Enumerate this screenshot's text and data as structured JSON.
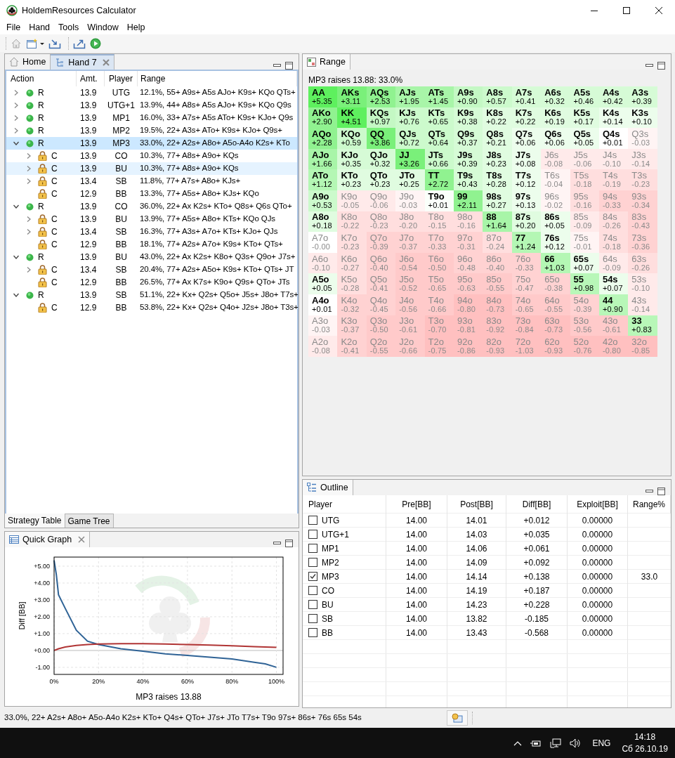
{
  "window": {
    "title": "HoldemResources Calculator"
  },
  "menu": [
    "File",
    "Hand",
    "Tools",
    "Window",
    "Help"
  ],
  "editor_tabs": [
    {
      "label": "Home",
      "selected": false,
      "closable": false
    },
    {
      "label": "Hand 7",
      "selected": true,
      "closable": true
    }
  ],
  "strategy_table": {
    "columns": [
      "Action",
      "Amt.",
      "Player",
      "Range"
    ],
    "rows": [
      {
        "action": "R",
        "kind": "raise",
        "amount": "13.9",
        "player": "UTG",
        "range": "12.1%, 55+ A9s+ A5s AJo+ K9s+ KQo QTs+",
        "expanded": false,
        "selected": false
      },
      {
        "action": "R",
        "kind": "raise",
        "amount": "13.9",
        "player": "UTG+1",
        "range": "13.9%, 44+ A8s+ A5s AJo+ K9s+ KQo Q9s",
        "expanded": false,
        "selected": false
      },
      {
        "action": "R",
        "kind": "raise",
        "amount": "13.9",
        "player": "MP1",
        "range": "16.0%, 33+ A7s+ A5s ATo+ K9s+ KJo+ Q9s",
        "expanded": false,
        "selected": false
      },
      {
        "action": "R",
        "kind": "raise",
        "amount": "13.9",
        "player": "MP2",
        "range": "19.5%, 22+ A3s+ ATo+ K9s+ KJo+ Q9s+",
        "expanded": false,
        "selected": false
      },
      {
        "action": "R",
        "kind": "raise",
        "amount": "13.9",
        "player": "MP3",
        "range": "33.0%, 22+ A2s+ A8o+ A5o-A4o K2s+ KTo",
        "expanded": true,
        "selected": true,
        "children": [
          {
            "action": "C",
            "kind": "call",
            "amount": "13.9",
            "player": "CO",
            "range": "10.3%, 77+ A8s+ A9o+ KQs",
            "expanded": false,
            "selected": false
          },
          {
            "action": "C",
            "kind": "call",
            "amount": "13.9",
            "player": "BU",
            "range": "10.3%, 77+ A8s+ A9o+ KQs",
            "expanded": false,
            "selected": false,
            "highlighted": true
          },
          {
            "action": "C",
            "kind": "call",
            "amount": "13.4",
            "player": "SB",
            "range": "11.8%, 77+ A7s+ A8o+ KJs+",
            "expanded": false,
            "selected": false
          },
          {
            "action": "C",
            "kind": "call",
            "amount": "12.9",
            "player": "BB",
            "range": "13.3%, 77+ A5s+ A8o+ KJs+ KQo",
            "selected": false
          }
        ]
      },
      {
        "action": "R",
        "kind": "raise",
        "amount": "13.9",
        "player": "CO",
        "range": "36.0%, 22+ Ax K2s+ KTo+ Q8s+ Q6s QTo+",
        "expanded": true,
        "selected": false,
        "children": [
          {
            "action": "C",
            "kind": "call",
            "amount": "13.9",
            "player": "BU",
            "range": "13.9%, 77+ A5s+ A8o+ KTs+ KQo QJs",
            "expanded": false,
            "selected": false
          },
          {
            "action": "C",
            "kind": "call",
            "amount": "13.4",
            "player": "SB",
            "range": "16.3%, 77+ A3s+ A7o+ KTs+ KJo+ QJs",
            "expanded": false,
            "selected": false
          },
          {
            "action": "C",
            "kind": "call",
            "amount": "12.9",
            "player": "BB",
            "range": "18.1%, 77+ A2s+ A7o+ K9s+ KTo+ QTs+",
            "selected": false
          }
        ]
      },
      {
        "action": "R",
        "kind": "raise",
        "amount": "13.9",
        "player": "BU",
        "range": "43.0%, 22+ Ax K2s+ K8o+ Q3s+ Q9o+ J7s+",
        "expanded": true,
        "selected": false,
        "children": [
          {
            "action": "C",
            "kind": "call",
            "amount": "13.4",
            "player": "SB",
            "range": "20.4%, 77+ A2s+ A5o+ K9s+ KTo+ QTs+ JT",
            "expanded": false,
            "selected": false
          },
          {
            "action": "C",
            "kind": "call",
            "amount": "12.9",
            "player": "BB",
            "range": "26.5%, 77+ Ax K7s+ K9o+ Q9s+ QTo+ JTs",
            "selected": false
          }
        ]
      },
      {
        "action": "R",
        "kind": "raise",
        "amount": "13.9",
        "player": "SB",
        "range": "51.1%, 22+ Kx+ Q2s+ Q5o+ J5s+ J8o+ T7s+",
        "expanded": true,
        "selected": false,
        "children": [
          {
            "action": "C",
            "kind": "call",
            "amount": "12.9",
            "player": "BB",
            "range": "53.8%, 22+ Kx+ Q2s+ Q4o+ J2s+ J8o+ T3s+",
            "selected": false
          }
        ]
      }
    ]
  },
  "view_tabs": [
    {
      "label": "Strategy Table",
      "selected": true
    },
    {
      "label": "Game Tree",
      "selected": false
    }
  ],
  "quick_graph": {
    "title": "Quick Graph",
    "chart_data": {
      "type": "line",
      "xlabel": "MP3 raises 13.88",
      "ylabel": "Diff [BB]",
      "x": [
        0,
        1,
        2,
        5,
        10,
        15,
        20,
        30,
        40,
        50,
        60,
        70,
        80,
        90,
        95,
        100
      ],
      "grid": true,
      "series": [
        {
          "color": "#2f6396",
          "values": [
            5.35,
            4.5,
            3.3,
            2.5,
            1.2,
            0.55,
            0.35,
            0.1,
            -0.05,
            -0.2,
            -0.3,
            -0.4,
            -0.5,
            -0.7,
            -0.8,
            -1.0
          ]
        },
        {
          "color": "#b03434",
          "values": [
            0,
            0.05,
            0.1,
            0.2,
            0.3,
            0.35,
            0.38,
            0.4,
            0.4,
            0.38,
            0.35,
            0.32,
            0.28,
            0.22,
            0.2,
            0.18
          ]
        }
      ],
      "xlim": [
        0,
        103
      ],
      "ylim": [
        -1.42,
        5.54
      ],
      "xticks": [
        {
          "value": 0,
          "label": "0%"
        },
        {
          "value": 20,
          "label": "20%"
        },
        {
          "value": 40,
          "label": "40%"
        },
        {
          "value": 60,
          "label": "60%"
        },
        {
          "value": 80,
          "label": "80%"
        },
        {
          "value": 100,
          "label": "100%"
        }
      ],
      "yticks": [
        {
          "value": 5,
          "label": "+5.00"
        },
        {
          "value": 4,
          "label": "+4.00"
        },
        {
          "value": 3,
          "label": "+3.00"
        },
        {
          "value": 2,
          "label": "+2.00"
        },
        {
          "value": 1,
          "label": "+1.00"
        },
        {
          "value": 0,
          "label": "+0.00"
        },
        {
          "value": -1,
          "label": "-1.00"
        }
      ]
    }
  },
  "range": {
    "title": "Range",
    "caption": "MP3 raises 13.88: 33.0%",
    "grid": [
      [
        {
          "hand": "AA",
          "ev": "+5.35",
          "in_range": true,
          "color": "#5ef05e"
        },
        {
          "hand": "AKs",
          "ev": "+3.11",
          "in_range": true,
          "color": "#7af07a"
        },
        {
          "hand": "AQs",
          "ev": "+2.53",
          "in_range": true,
          "color": "#90f290"
        },
        {
          "hand": "AJs",
          "ev": "+1.95",
          "in_range": true,
          "color": "#a8f5a8"
        },
        {
          "hand": "ATs",
          "ev": "+1.45",
          "in_range": true,
          "color": "#a8f5a8"
        },
        {
          "hand": "A9s",
          "ev": "+0.90",
          "in_range": true,
          "color": "#c4f8c4"
        },
        {
          "hand": "A8s",
          "ev": "+0.57",
          "in_range": true,
          "color": "#ccfacc"
        },
        {
          "hand": "A7s",
          "ev": "+0.41",
          "in_range": true,
          "color": "#d6fbd6"
        },
        {
          "hand": "A6s",
          "ev": "+0.32",
          "in_range": true,
          "color": "#d6fbd6"
        },
        {
          "hand": "A5s",
          "ev": "+0.46",
          "in_range": true,
          "color": "#d6fbd6"
        },
        {
          "hand": "A4s",
          "ev": "+0.42",
          "in_range": true,
          "color": "#d6fbd6"
        },
        {
          "hand": "A3s",
          "ev": "+0.39",
          "in_range": true,
          "color": "#d6fbd6"
        }
      ],
      [
        {
          "hand": "AKo",
          "ev": "+2.90",
          "in_range": true,
          "color": "#90f290"
        },
        {
          "hand": "KK",
          "ev": "+4.51",
          "in_range": true,
          "color": "#5ef05e"
        },
        {
          "hand": "KQs",
          "ev": "+0.97",
          "in_range": true,
          "color": "#c4f8c4"
        },
        {
          "hand": "KJs",
          "ev": "+0.76",
          "in_range": true,
          "color": "#ccfacc"
        },
        {
          "hand": "KTs",
          "ev": "+0.65",
          "in_range": true,
          "color": "#ccfacc"
        },
        {
          "hand": "K9s",
          "ev": "+0.38",
          "in_range": true,
          "color": "#d6fbd6"
        },
        {
          "hand": "K8s",
          "ev": "+0.22",
          "in_range": true,
          "color": "#e0fce0"
        },
        {
          "hand": "K7s",
          "ev": "+0.22",
          "in_range": true,
          "color": "#e0fce0"
        },
        {
          "hand": "K6s",
          "ev": "+0.19",
          "in_range": true,
          "color": "#e0fce0"
        },
        {
          "hand": "K5s",
          "ev": "+0.17",
          "in_range": true,
          "color": "#e0fce0"
        },
        {
          "hand": "K4s",
          "ev": "+0.14",
          "in_range": true,
          "color": "#ecfdec"
        },
        {
          "hand": "K3s",
          "ev": "+0.10",
          "in_range": true,
          "color": "#ecfdec"
        }
      ],
      [
        {
          "hand": "AQo",
          "ev": "+2.28",
          "in_range": true,
          "color": "#90f290"
        },
        {
          "hand": "KQo",
          "ev": "+0.59",
          "in_range": true,
          "color": "#ccfacc"
        },
        {
          "hand": "QQ",
          "ev": "+3.86",
          "in_range": true,
          "color": "#7af07a"
        },
        {
          "hand": "QJs",
          "ev": "+0.72",
          "in_range": true,
          "color": "#ccfacc"
        },
        {
          "hand": "QTs",
          "ev": "+0.64",
          "in_range": true,
          "color": "#ccfacc"
        },
        {
          "hand": "Q9s",
          "ev": "+0.37",
          "in_range": true,
          "color": "#d6fbd6"
        },
        {
          "hand": "Q8s",
          "ev": "+0.21",
          "in_range": true,
          "color": "#e0fce0"
        },
        {
          "hand": "Q7s",
          "ev": "+0.06",
          "in_range": true,
          "color": "#ecfdec"
        },
        {
          "hand": "Q6s",
          "ev": "+0.06",
          "in_range": true,
          "color": "#ecfdec"
        },
        {
          "hand": "Q5s",
          "ev": "+0.05",
          "in_range": true,
          "color": "#ecfdec"
        },
        {
          "hand": "Q4s",
          "ev": "+0.01",
          "in_range": true,
          "color": "#ffffff"
        },
        {
          "hand": "Q3s",
          "ev": "-0.03",
          "in_range": false,
          "color": "#fff4f4"
        }
      ],
      [
        {
          "hand": "AJo",
          "ev": "+1.66",
          "in_range": true,
          "color": "#a8f5a8"
        },
        {
          "hand": "KJo",
          "ev": "+0.35",
          "in_range": true,
          "color": "#d6fbd6"
        },
        {
          "hand": "QJo",
          "ev": "+0.32",
          "in_range": true,
          "color": "#d6fbd6"
        },
        {
          "hand": "JJ",
          "ev": "+3.26",
          "in_range": true,
          "color": "#7af07a"
        },
        {
          "hand": "JTs",
          "ev": "+0.66",
          "in_range": true,
          "color": "#ccfacc"
        },
        {
          "hand": "J9s",
          "ev": "+0.39",
          "in_range": true,
          "color": "#d6fbd6"
        },
        {
          "hand": "J8s",
          "ev": "+0.23",
          "in_range": true,
          "color": "#e0fce0"
        },
        {
          "hand": "J7s",
          "ev": "+0.08",
          "in_range": true,
          "color": "#ecfdec"
        },
        {
          "hand": "J6s",
          "ev": "-0.08",
          "in_range": false,
          "color": "#ffeaea"
        },
        {
          "hand": "J5s",
          "ev": "-0.06",
          "in_range": false,
          "color": "#ffeaea"
        },
        {
          "hand": "J4s",
          "ev": "-0.10",
          "in_range": false,
          "color": "#ffeaea"
        },
        {
          "hand": "J3s",
          "ev": "-0.14",
          "in_range": false,
          "color": "#ffeaea"
        }
      ],
      [
        {
          "hand": "ATo",
          "ev": "+1.12",
          "in_range": true,
          "color": "#b4f7b4"
        },
        {
          "hand": "KTo",
          "ev": "+0.23",
          "in_range": true,
          "color": "#e0fce0"
        },
        {
          "hand": "QTo",
          "ev": "+0.23",
          "in_range": true,
          "color": "#e0fce0"
        },
        {
          "hand": "JTo",
          "ev": "+0.25",
          "in_range": true,
          "color": "#e0fce0"
        },
        {
          "hand": "TT",
          "ev": "+2.72",
          "in_range": true,
          "color": "#90f290"
        },
        {
          "hand": "T9s",
          "ev": "+0.43",
          "in_range": true,
          "color": "#d6fbd6"
        },
        {
          "hand": "T8s",
          "ev": "+0.28",
          "in_range": true,
          "color": "#e0fce0"
        },
        {
          "hand": "T7s",
          "ev": "+0.12",
          "in_range": true,
          "color": "#ecfdec"
        },
        {
          "hand": "T6s",
          "ev": "-0.04",
          "in_range": false,
          "color": "#fff4f4"
        },
        {
          "hand": "T5s",
          "ev": "-0.18",
          "in_range": false,
          "color": "#ffdede"
        },
        {
          "hand": "T4s",
          "ev": "-0.19",
          "in_range": false,
          "color": "#ffdede"
        },
        {
          "hand": "T3s",
          "ev": "-0.23",
          "in_range": false,
          "color": "#ffdede"
        }
      ],
      [
        {
          "hand": "A9o",
          "ev": "+0.53",
          "in_range": true,
          "color": "#ccfacc"
        },
        {
          "hand": "K9o",
          "ev": "-0.05",
          "in_range": false,
          "color": "#ffeaea"
        },
        {
          "hand": "Q9o",
          "ev": "-0.06",
          "in_range": false,
          "color": "#ffeaea"
        },
        {
          "hand": "J9o",
          "ev": "-0.03",
          "in_range": false,
          "color": "#fff4f4"
        },
        {
          "hand": "T9o",
          "ev": "+0.01",
          "in_range": true,
          "color": "#fafffa"
        },
        {
          "hand": "99",
          "ev": "+2.11",
          "in_range": true,
          "color": "#90f290"
        },
        {
          "hand": "98s",
          "ev": "+0.27",
          "in_range": true,
          "color": "#e0fce0"
        },
        {
          "hand": "97s",
          "ev": "+0.13",
          "in_range": true,
          "color": "#ecfdec"
        },
        {
          "hand": "96s",
          "ev": "-0.02",
          "in_range": false,
          "color": "#fff4f4"
        },
        {
          "hand": "95s",
          "ev": "-0.16",
          "in_range": false,
          "color": "#ffdede"
        },
        {
          "hand": "94s",
          "ev": "-0.33",
          "in_range": false,
          "color": "#ffd2d2"
        },
        {
          "hand": "93s",
          "ev": "-0.34",
          "in_range": false,
          "color": "#ffd2d2"
        }
      ],
      [
        {
          "hand": "A8o",
          "ev": "+0.18",
          "in_range": true,
          "color": "#e0fce0"
        },
        {
          "hand": "K8o",
          "ev": "-0.22",
          "in_range": false,
          "color": "#ffdede"
        },
        {
          "hand": "Q8o",
          "ev": "-0.23",
          "in_range": false,
          "color": "#ffdede"
        },
        {
          "hand": "J8o",
          "ev": "-0.20",
          "in_range": false,
          "color": "#ffdede"
        },
        {
          "hand": "T8o",
          "ev": "-0.15",
          "in_range": false,
          "color": "#ffdede"
        },
        {
          "hand": "98o",
          "ev": "-0.16",
          "in_range": false,
          "color": "#ffdede"
        },
        {
          "hand": "88",
          "ev": "+1.64",
          "in_range": true,
          "color": "#a8f5a8"
        },
        {
          "hand": "87s",
          "ev": "+0.20",
          "in_range": true,
          "color": "#e0fce0"
        },
        {
          "hand": "86s",
          "ev": "+0.05",
          "in_range": true,
          "color": "#ecfdec"
        },
        {
          "hand": "85s",
          "ev": "-0.09",
          "in_range": false,
          "color": "#ffeaea"
        },
        {
          "hand": "84s",
          "ev": "-0.26",
          "in_range": false,
          "color": "#ffdede"
        },
        {
          "hand": "83s",
          "ev": "-0.43",
          "in_range": false,
          "color": "#ffd2d2"
        }
      ],
      [
        {
          "hand": "A7o",
          "ev": "-0.00",
          "in_range": false,
          "color": "#ffffff"
        },
        {
          "hand": "K7o",
          "ev": "-0.23",
          "in_range": false,
          "color": "#ffdede"
        },
        {
          "hand": "Q7o",
          "ev": "-0.39",
          "in_range": false,
          "color": "#ffd2d2"
        },
        {
          "hand": "J7o",
          "ev": "-0.37",
          "in_range": false,
          "color": "#ffd2d2"
        },
        {
          "hand": "T7o",
          "ev": "-0.33",
          "in_range": false,
          "color": "#ffd2d2"
        },
        {
          "hand": "97o",
          "ev": "-0.31",
          "in_range": false,
          "color": "#ffd2d2"
        },
        {
          "hand": "87o",
          "ev": "-0.24",
          "in_range": false,
          "color": "#ffdede"
        },
        {
          "hand": "77",
          "ev": "+1.24",
          "in_range": true,
          "color": "#b4f7b4"
        },
        {
          "hand": "76s",
          "ev": "+0.12",
          "in_range": true,
          "color": "#ecfdec"
        },
        {
          "hand": "75s",
          "ev": "-0.01",
          "in_range": false,
          "color": "#fff4f4"
        },
        {
          "hand": "74s",
          "ev": "-0.18",
          "in_range": false,
          "color": "#ffdede"
        },
        {
          "hand": "73s",
          "ev": "-0.36",
          "in_range": false,
          "color": "#ffd2d2"
        }
      ],
      [
        {
          "hand": "A6o",
          "ev": "-0.10",
          "in_range": false,
          "color": "#ffeaea"
        },
        {
          "hand": "K6o",
          "ev": "-0.27",
          "in_range": false,
          "color": "#ffdede"
        },
        {
          "hand": "Q6o",
          "ev": "-0.40",
          "in_range": false,
          "color": "#ffd2d2"
        },
        {
          "hand": "J6o",
          "ev": "-0.54",
          "in_range": false,
          "color": "#ffcaca"
        },
        {
          "hand": "T6o",
          "ev": "-0.50",
          "in_range": false,
          "color": "#ffcaca"
        },
        {
          "hand": "96o",
          "ev": "-0.48",
          "in_range": false,
          "color": "#ffd2d2"
        },
        {
          "hand": "86o",
          "ev": "-0.40",
          "in_range": false,
          "color": "#ffd2d2"
        },
        {
          "hand": "76o",
          "ev": "-0.33",
          "in_range": false,
          "color": "#ffd2d2"
        },
        {
          "hand": "66",
          "ev": "+1.03",
          "in_range": true,
          "color": "#b4f7b4"
        },
        {
          "hand": "65s",
          "ev": "+0.07",
          "in_range": true,
          "color": "#ecfdec"
        },
        {
          "hand": "64s",
          "ev": "-0.09",
          "in_range": false,
          "color": "#ffeaea"
        },
        {
          "hand": "63s",
          "ev": "-0.26",
          "in_range": false,
          "color": "#ffdede"
        }
      ],
      [
        {
          "hand": "A5o",
          "ev": "+0.05",
          "in_range": true,
          "color": "#ecfdec"
        },
        {
          "hand": "K5o",
          "ev": "-0.28",
          "in_range": false,
          "color": "#ffdede"
        },
        {
          "hand": "Q5o",
          "ev": "-0.41",
          "in_range": false,
          "color": "#ffd2d2"
        },
        {
          "hand": "J5o",
          "ev": "-0.52",
          "in_range": false,
          "color": "#ffcaca"
        },
        {
          "hand": "T5o",
          "ev": "-0.65",
          "in_range": false,
          "color": "#ffcaca"
        },
        {
          "hand": "95o",
          "ev": "-0.63",
          "in_range": false,
          "color": "#ffcaca"
        },
        {
          "hand": "85o",
          "ev": "-0.55",
          "in_range": false,
          "color": "#ffcaca"
        },
        {
          "hand": "75o",
          "ev": "-0.47",
          "in_range": false,
          "color": "#ffd2d2"
        },
        {
          "hand": "65o",
          "ev": "-0.38",
          "in_range": false,
          "color": "#ffd2d2"
        },
        {
          "hand": "55",
          "ev": "+0.98",
          "in_range": true,
          "color": "#b8f7b8"
        },
        {
          "hand": "54s",
          "ev": "+0.07",
          "in_range": true,
          "color": "#ecfdec"
        },
        {
          "hand": "53s",
          "ev": "-0.10",
          "in_range": false,
          "color": "#ffeaea"
        }
      ],
      [
        {
          "hand": "A4o",
          "ev": "+0.01",
          "in_range": true,
          "color": "#ffffff"
        },
        {
          "hand": "K4o",
          "ev": "-0.32",
          "in_range": false,
          "color": "#ffd2d2"
        },
        {
          "hand": "Q4o",
          "ev": "-0.45",
          "in_range": false,
          "color": "#ffd2d2"
        },
        {
          "hand": "J4o",
          "ev": "-0.56",
          "in_range": false,
          "color": "#ffcaca"
        },
        {
          "hand": "T4o",
          "ev": "-0.66",
          "in_range": false,
          "color": "#ffcaca"
        },
        {
          "hand": "94o",
          "ev": "-0.80",
          "in_range": false,
          "color": "#ffc0c0"
        },
        {
          "hand": "84o",
          "ev": "-0.73",
          "in_range": false,
          "color": "#ffc0c0"
        },
        {
          "hand": "74o",
          "ev": "-0.65",
          "in_range": false,
          "color": "#ffcaca"
        },
        {
          "hand": "64o",
          "ev": "-0.55",
          "in_range": false,
          "color": "#ffcaca"
        },
        {
          "hand": "54o",
          "ev": "-0.39",
          "in_range": false,
          "color": "#ffd2d2"
        },
        {
          "hand": "44",
          "ev": "+0.90",
          "in_range": true,
          "color": "#b8f7b8"
        },
        {
          "hand": "43s",
          "ev": "-0.14",
          "in_range": false,
          "color": "#ffeaea"
        }
      ],
      [
        {
          "hand": "A3o",
          "ev": "-0.03",
          "in_range": false,
          "color": "#fff4f4"
        },
        {
          "hand": "K3o",
          "ev": "-0.37",
          "in_range": false,
          "color": "#ffd2d2"
        },
        {
          "hand": "Q3o",
          "ev": "-0.50",
          "in_range": false,
          "color": "#ffcaca"
        },
        {
          "hand": "J3o",
          "ev": "-0.61",
          "in_range": false,
          "color": "#ffcaca"
        },
        {
          "hand": "T3o",
          "ev": "-0.70",
          "in_range": false,
          "color": "#ffc0c0"
        },
        {
          "hand": "93o",
          "ev": "-0.81",
          "in_range": false,
          "color": "#ffc0c0"
        },
        {
          "hand": "83o",
          "ev": "-0.92",
          "in_range": false,
          "color": "#ffc0c0"
        },
        {
          "hand": "73o",
          "ev": "-0.84",
          "in_range": false,
          "color": "#ffc0c0"
        },
        {
          "hand": "63o",
          "ev": "-0.73",
          "in_range": false,
          "color": "#ffc0c0"
        },
        {
          "hand": "53o",
          "ev": "-0.56",
          "in_range": false,
          "color": "#ffcaca"
        },
        {
          "hand": "43o",
          "ev": "-0.61",
          "in_range": false,
          "color": "#ffcaca"
        },
        {
          "hand": "33",
          "ev": "+0.83",
          "in_range": true,
          "color": "#b8f7b8"
        }
      ],
      [
        {
          "hand": "A2o",
          "ev": "-0.08",
          "in_range": false,
          "color": "#ffeaea"
        },
        {
          "hand": "K2o",
          "ev": "-0.41",
          "in_range": false,
          "color": "#ffd2d2"
        },
        {
          "hand": "Q2o",
          "ev": "-0.55",
          "in_range": false,
          "color": "#ffcaca"
        },
        {
          "hand": "J2o",
          "ev": "-0.66",
          "in_range": false,
          "color": "#ffcaca"
        },
        {
          "hand": "T2o",
          "ev": "-0.75",
          "in_range": false,
          "color": "#ffc0c0"
        },
        {
          "hand": "92o",
          "ev": "-0.86",
          "in_range": false,
          "color": "#ffc0c0"
        },
        {
          "hand": "82o",
          "ev": "-0.93",
          "in_range": false,
          "color": "#ffc0c0"
        },
        {
          "hand": "72o",
          "ev": "-1.03",
          "in_range": false,
          "color": "#ffc0c0"
        },
        {
          "hand": "62o",
          "ev": "-0.93",
          "in_range": false,
          "color": "#ffc0c0"
        },
        {
          "hand": "52o",
          "ev": "-0.76",
          "in_range": false,
          "color": "#ffc0c0"
        },
        {
          "hand": "42o",
          "ev": "-0.80",
          "in_range": false,
          "color": "#ffc0c0"
        },
        {
          "hand": "32o",
          "ev": "-0.85",
          "in_range": false,
          "color": "#ffc0c0"
        }
      ]
    ]
  },
  "outline": {
    "title": "Outline",
    "columns": [
      "Player",
      "Pre[BB]",
      "Post[BB]",
      "Diff[BB]",
      "Exploit[BB]",
      "Range%"
    ],
    "rows": [
      {
        "player": "UTG",
        "checked": false,
        "pre": "14.00",
        "post": "14.01",
        "diff": "+0.012",
        "exploit": "0.00000"
      },
      {
        "player": "UTG+1",
        "checked": false,
        "pre": "14.00",
        "post": "14.03",
        "diff": "+0.035",
        "exploit": "0.00000"
      },
      {
        "player": "MP1",
        "checked": false,
        "pre": "14.00",
        "post": "14.06",
        "diff": "+0.061",
        "exploit": "0.00000"
      },
      {
        "player": "MP2",
        "checked": false,
        "pre": "14.00",
        "post": "14.09",
        "diff": "+0.092",
        "exploit": "0.00000"
      },
      {
        "player": "MP3",
        "checked": true,
        "pre": "14.00",
        "post": "14.14",
        "diff": "+0.138",
        "exploit": "0.00000",
        "range_pct": "33.0"
      },
      {
        "player": "CO",
        "checked": false,
        "pre": "14.00",
        "post": "14.19",
        "diff": "+0.187",
        "exploit": "0.00000"
      },
      {
        "player": "BU",
        "checked": false,
        "pre": "14.00",
        "post": "14.23",
        "diff": "+0.228",
        "exploit": "0.00000"
      },
      {
        "player": "SB",
        "checked": false,
        "pre": "14.00",
        "post": "13.82",
        "diff": "-0.185",
        "exploit": "0.00000"
      },
      {
        "player": "BB",
        "checked": false,
        "pre": "14.00",
        "post": "13.43",
        "diff": "-0.568",
        "exploit": "0.00000"
      }
    ]
  },
  "status_bar": {
    "text": "33.0%, 22+ A2s+ A8o+ A5o-A4o K2s+ KTo+ Q4s+ QTo+ J7s+ JTo T7s+ T9o 97s+ 86s+ 76s 65s 54s"
  },
  "taskbar": {
    "language": "ENG",
    "time": "14:18",
    "date": "Сб 26.10.19"
  }
}
